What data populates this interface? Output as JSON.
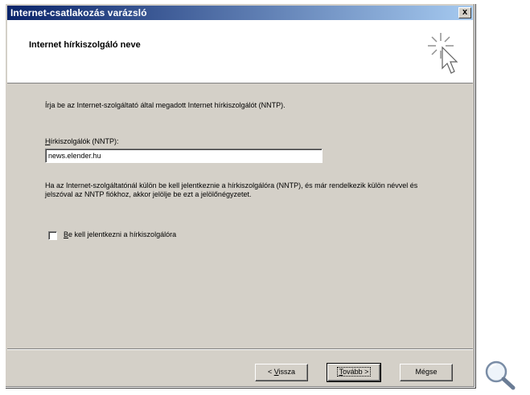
{
  "window": {
    "title": "Internet-csatlakozás varázsló",
    "close_label": "x"
  },
  "header": {
    "title": "Internet hírkiszolgáló neve"
  },
  "content": {
    "intro": "Írja be az Internet-szolgáltató által megadott Internet hírkiszolgálót (NNTP).",
    "field_label_accel": "H",
    "field_label_rest": "írkiszolgálók (NNTP):",
    "field_value": "news.elender.hu",
    "description": "Ha az Internet-szolgáltatónál külön be kell jelentkeznie a hírkiszolgálóra (NNTP), és már rendelkezik külön névvel és jelszóval az NNTP fiókhoz, akkor jelölje be ezt a jelölőnégyzetet.",
    "checkbox_label_accel": "B",
    "checkbox_label_rest": "e kell jelentkezni a hírkiszolgálóra",
    "checkbox_checked": false
  },
  "buttons": {
    "back_prefix": "< ",
    "back_accel": "V",
    "back_rest": "issza",
    "next_accel": "T",
    "next_rest": "ovább >",
    "cancel": "Mégse"
  },
  "icons": [
    "wizard-cursor-icon",
    "magnifier-icon"
  ],
  "colors": {
    "title_gradient_start": "#0a246a",
    "title_gradient_end": "#a6caf0",
    "dialog_face": "#d4d0c8"
  }
}
